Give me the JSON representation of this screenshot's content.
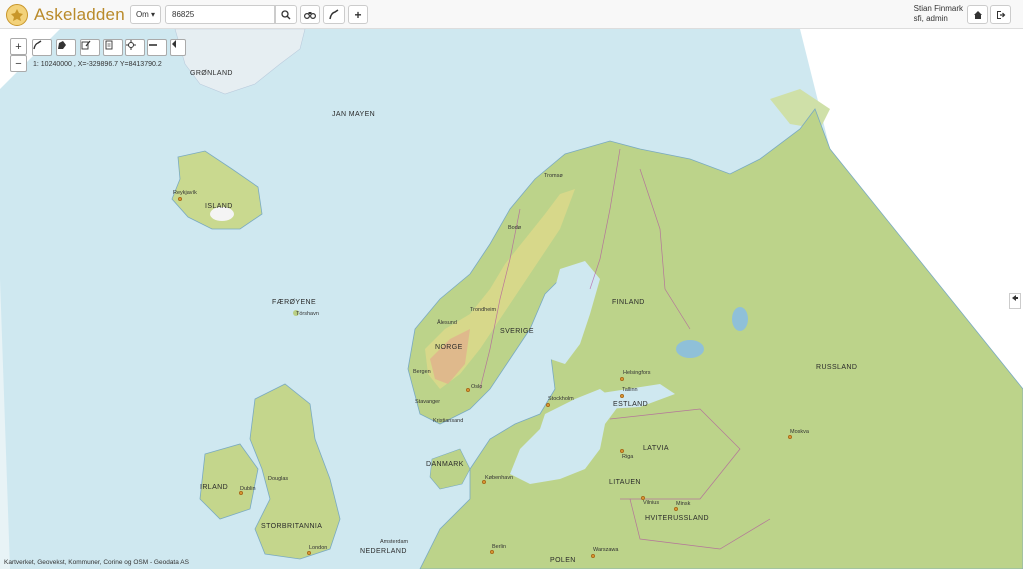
{
  "app": {
    "title": "Askeladden"
  },
  "toolbar": {
    "about_label": "Om ▾",
    "search_value": "86825",
    "home_label": "⌂",
    "logout_label": "⇥"
  },
  "user": {
    "name": "Stian Finmark",
    "role": "sfi, admin"
  },
  "map": {
    "zoom_in": "+",
    "zoom_out": "−",
    "scale_text": "1: 10240000 , X=-329896.7 Y=8413790.2",
    "attribution": "Kartverket, Geovekst, Kommuner, Corine og OSM - Geodata AS",
    "country_labels": [
      "GRØNLAND",
      "JAN MAYEN",
      "ISLAND",
      "FÆRØYENE",
      "NORGE",
      "SVERIGE",
      "FINLAND",
      "RUSSLAND",
      "ESTLAND",
      "LATVIA",
      "LITAUEN",
      "HVITERUSSLAND",
      "DANMARK",
      "IRLAND",
      "STORBRITANNIA",
      "NEDERLAND",
      "POLEN"
    ],
    "city_labels": [
      "Reykjavík",
      "Tórshavn",
      "Tromsø",
      "Bodø",
      "Trondheim",
      "Ålesund",
      "Bergen",
      "Oslo",
      "Stavanger",
      "Kristiansand",
      "Stockholm",
      "Helsingfors",
      "Tallinn",
      "Moskva",
      "Riga",
      "Vilnius",
      "Minsk",
      "København",
      "Dublin",
      "Douglas",
      "Amsterdam",
      "London",
      "Berlin",
      "Warszawa"
    ]
  }
}
